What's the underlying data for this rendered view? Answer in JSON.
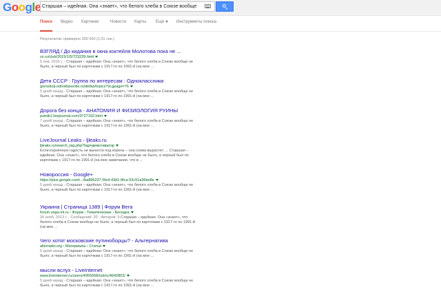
{
  "header": {
    "logo": [
      "G",
      "o",
      "o",
      "g",
      "l",
      "e"
    ],
    "logo_colors": [
      "#4285f4",
      "#ea4335",
      "#fbbc05",
      "#4285f4",
      "#34a853",
      "#ea4335"
    ],
    "search_value": "Старшая – идейная. Она «знает», что белого хлеба в Союзе вообще не",
    "keyboard_icon": "keyboard-icon",
    "search_icon": "search-icon"
  },
  "tabs": [
    "Поиск",
    "Видео",
    "Картинки",
    "Новости",
    "Карты",
    "Ещё",
    "Инструменты поиска"
  ],
  "stats": "Результатов: примерно 330 000 (1,01 сек.)",
  "colors": {
    "accent": "#dd4b39",
    "link": "#1a0dab",
    "url": "#006621",
    "snippet": "#545454",
    "button": "#4d90fe"
  },
  "results": [
    {
      "title": "ВЗГЛЯД / До кидания в окна коктейля Молотова пока не ...",
      "url": "vz.ru/club/2015/1/5/723239.html",
      "date": "5 янв. 2015 г. -",
      "snippet": "Старшая – идейная. Она «знает», что белого хлеба в Союзе вообще не было, а черный был по карточкам с 1917-го по 1991-й (на мое ..."
    },
    {
      "title": "Дети СССР : Группа по интересам : Одноклассники",
      "url": "goroskop.odnoklassniki.ru/dellas/topics?st.gpage=76",
      "date": "5 дней назад -",
      "snippet": "Старшая – идейная. Она «знает», что белого хлеба в Союзе вообще не было, а черный был по карточкам с 1917-го по 1991-й (на мое ..."
    },
    {
      "title": "Дорога без конца - АНАТОМИЯ И ФИЗИОЛОГИЯ РУИНЫ",
      "url": "putnik1.livejournal.com/3727192.html",
      "date": "7 дней назад -",
      "snippet": "Старшая – идейная. Она «знает», что белого хлеба в Союзе вообще не было, а черный был по карточкам с 1917-го по 1991-й (на мое ..."
    },
    {
      "title": "LiveJournal Leaks - ljleaks.ru",
      "url": "ljleaks.ru/search_tag.php?tag=демотиватор",
      "date": "",
      "snippet": "Если корнечную гадость не вынести под корень – она снова вырастет. ... Старшая – идейная. Она «знает», что белого хлеба в Союзе вообще не было, а черный был по карточкам с 1917-го по 1991-й (на мое замечание, что в ..."
    },
    {
      "title": "Новороссия - Google+",
      "url": "https://plus.google.com/.../ba896237-f3e4-43d1-8fca-53c51a36be8e",
      "date": "5 дней назад -",
      "snippet": "Старшая – идейная. Она «знает», что белого хлеба в Союзе вообще не было, а черный был по карточкам с 1917-го по 1991-й (на мое ..."
    },
    {
      "title": "Украина | Страница 1389 | Форум Вега",
      "url": "forum.vega-int.ru › Форум › Тематические › Беседка",
      "date": "26 нояб. 2013 г. - Сообщений: 20 - Авторов: 9",
      "snippet": "Старшая – идейная. Она «знает», что белого хлеба в Союзе вообще не было, а черный был по карточкам с 1917-го по 1991-й (на мое ..."
    },
    {
      "title": "Чего хотят московские путинобоpцы? - Альтернатива",
      "url": "alternatio.org › Материалы › Статьи",
      "date": "6 дней назад -",
      "snippet": "Старшая – идейная. Она «знает», что белого хлеба в Союзе вообще не было, а черный был по карточкам с 1917-го по 1991-й (на мое ..."
    },
    {
      "title": "мысли вслух - LiveInternet",
      "url": "www.liveinternet.ru/users/4955658/rubric/4642802/",
      "date": "5 дней назад -",
      "snippet": "Старшая – идейная. Она «знает», что белого хлеба в Союзе вообще не было, а черный был по карточкам с 1917-го по 1991-й (на мое ..."
    }
  ]
}
